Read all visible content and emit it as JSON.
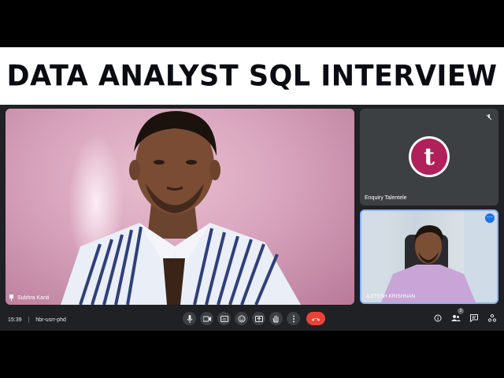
{
  "banner": {
    "title": "DATA ANALYST SQL INTERVIEW"
  },
  "main_tile": {
    "name": "Subhra Kanti"
  },
  "side_top": {
    "name": "Enquiry Talentele",
    "avatar_letter": "t",
    "avatar_color": "#b0205a"
  },
  "side_bottom": {
    "name": "AJITESH KRISHNAN",
    "more_label": "⋯"
  },
  "meeting": {
    "time": "15:39",
    "code": "hbr-usrr-phd",
    "participants_count": "3"
  },
  "controls": [
    {
      "name": "mic-button",
      "icon": "mic-icon"
    },
    {
      "name": "camera-button",
      "icon": "camera-icon"
    },
    {
      "name": "captions-button",
      "icon": "captions-icon"
    },
    {
      "name": "emoji-button",
      "icon": "emoji-icon"
    },
    {
      "name": "present-button",
      "icon": "present-icon"
    },
    {
      "name": "raise-hand-button",
      "icon": "hand-icon"
    },
    {
      "name": "more-options-button",
      "icon": "more-vert-icon"
    },
    {
      "name": "leave-call-button",
      "icon": "end-call-icon"
    }
  ],
  "colors": {
    "end_call": "#ea4335",
    "toolbar_bg": "#202124",
    "active_border": "#8ab4f8"
  }
}
